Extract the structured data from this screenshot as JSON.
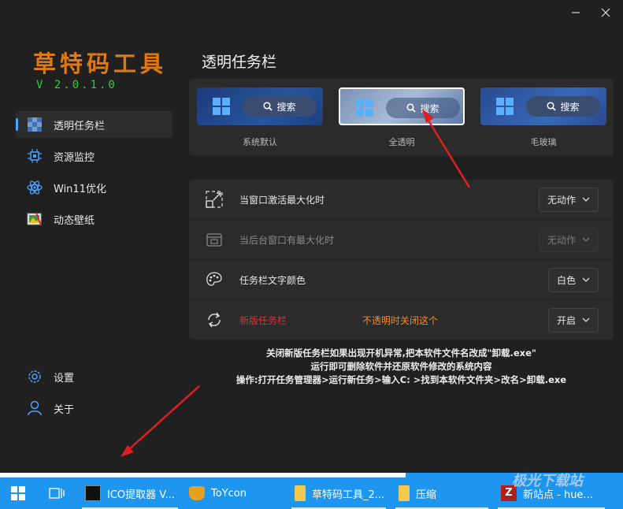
{
  "app": {
    "logo_text": "草特码工具",
    "version": "V 2.0.1.0"
  },
  "sidebar": {
    "items": [
      {
        "label": "透明任务栏",
        "icon": "mosaic-icon",
        "active": true
      },
      {
        "label": "资源监控",
        "icon": "chip-icon"
      },
      {
        "label": "Win11优化",
        "icon": "atom-icon"
      },
      {
        "label": "动态壁纸",
        "icon": "wallpaper-icon"
      }
    ],
    "bottom_items": [
      {
        "label": "设置",
        "icon": "gear-icon"
      },
      {
        "label": "关于",
        "icon": "user-icon"
      }
    ]
  },
  "main": {
    "title": "透明任务栏",
    "styles": [
      {
        "label": "系统默认",
        "search_text": "搜索"
      },
      {
        "label": "全透明",
        "search_text": "搜索",
        "selected": true
      },
      {
        "label": "毛玻璃",
        "search_text": "搜索"
      }
    ],
    "settings": [
      {
        "label": "当窗口激活最大化时",
        "value": "无动作",
        "icon": "maximize-icon"
      },
      {
        "label": "当后台窗口有最大化时",
        "value": "无动作",
        "icon": "window-background-icon",
        "disabled": true
      },
      {
        "label": "任务栏文字颜色",
        "value": "白色",
        "icon": "palette-icon"
      },
      {
        "label": "新版任务栏",
        "value": "开启",
        "icon": "refresh-icon",
        "note": "不透明时关闭这个",
        "label_color": "#e03030"
      }
    ],
    "notice": [
      "关闭新版任务栏如果出现开机异常,把本软件文件名改成\"卸载.exe\"",
      "运行即可删除软件并还原软件修改的系统内容",
      "操作:打开任务管理器>运行新任务>输入C: >找到本软件文件夹>改名>卸载.exe"
    ]
  },
  "taskbar": {
    "items": [
      {
        "label": "ICO提取器 V...",
        "icon": "ico-extractor-icon"
      },
      {
        "label": "ToYcon",
        "icon": "toycon-icon"
      },
      {
        "label": "草特码工具_2...",
        "icon": "folder-icon"
      },
      {
        "label": "压缩",
        "icon": "folder-icon"
      },
      {
        "label": "新站点 - hue...",
        "icon": "filezilla-icon"
      }
    ]
  },
  "watermark": "极光下载站",
  "colors": {
    "accent": "#4aa3ff",
    "logo": "#e07a10",
    "version": "#2fd12f",
    "warning": "#ff8a1a",
    "danger": "#e03030",
    "taskbar": "#1e96f0"
  }
}
